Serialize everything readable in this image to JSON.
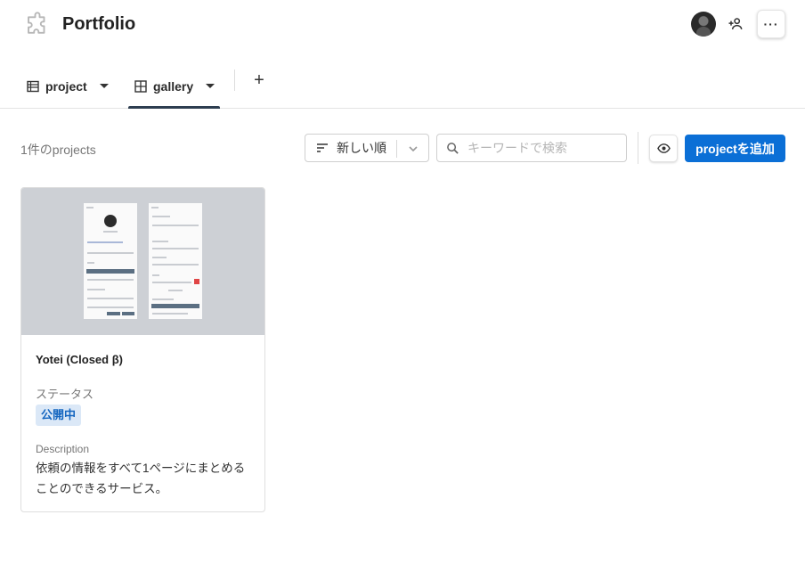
{
  "header": {
    "title": "Portfolio",
    "app_icon": "puzzle-icon",
    "more_label": "···"
  },
  "tabs": [
    {
      "label": "project",
      "icon": "table-icon"
    },
    {
      "label": "gallery",
      "icon": "grid-icon",
      "active": true
    }
  ],
  "tab_add_label": "+",
  "toolbar": {
    "count": "1件のprojects",
    "sort_label": "新しい順",
    "search_placeholder": "キーワードで検索",
    "add_label": "projectを追加"
  },
  "colors": {
    "accent": "#0b6fd6",
    "badge_bg": "#dbe8f7",
    "badge_text": "#1466c0"
  },
  "card": {
    "title": "Yotei (Closed β)",
    "status_label": "ステータス",
    "status_value": "公開中",
    "desc_label": "Description",
    "desc_text": "依頼の情報をすべて1ページにまとめることのできるサービス。"
  }
}
